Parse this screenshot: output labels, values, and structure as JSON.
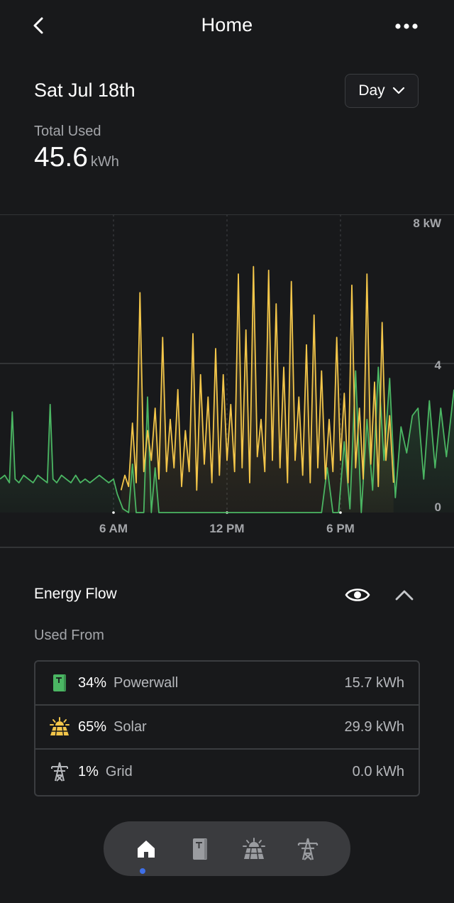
{
  "header": {
    "title": "Home"
  },
  "summary": {
    "date": "Sat Jul 18th",
    "period": "Day",
    "total_label": "Total Used",
    "total_value": "45.6",
    "total_unit": "kWh"
  },
  "colors": {
    "solar": "#f3c64a",
    "powerwall": "#4bb663",
    "accent": "#3e6fe8"
  },
  "chart_data": {
    "type": "line",
    "y_tick_labels": [
      "8 kW",
      "4",
      "0"
    ],
    "x_tick_labels": [
      "6 AM",
      "12 PM",
      "6 PM"
    ],
    "ylim": [
      0,
      8
    ],
    "xlim_hours": [
      0,
      24
    ],
    "series": [
      {
        "color": "#4bb663",
        "x": [
          0,
          0.25,
          0.5,
          0.65,
          0.8,
          1,
          1.25,
          1.5,
          1.75,
          2,
          2.25,
          2.5,
          2.65,
          2.8,
          3,
          3.25,
          3.5,
          3.75,
          4,
          4.25,
          4.5,
          4.75,
          5,
          5.25,
          5.5,
          5.75,
          6,
          6.2,
          6.5,
          6.8,
          7,
          7.2,
          7.4,
          7.6,
          7.8,
          8,
          8.2,
          8.4,
          8.6,
          8.8,
          9,
          9.5,
          10,
          10.5,
          11,
          11.5,
          12,
          12.5,
          13,
          13.5,
          14,
          14.5,
          15,
          15.5,
          16,
          16.5,
          17,
          17.3,
          17.6,
          17.9,
          18.2,
          18.5,
          18.8,
          19.1,
          19.4,
          19.7,
          20,
          20.3,
          20.6,
          20.9,
          21.2,
          21.5,
          21.8,
          22.1,
          22.4,
          22.7,
          23,
          23.3,
          23.6,
          24
        ],
        "values": [
          0.9,
          1,
          0.8,
          2.7,
          0.9,
          0.8,
          1,
          0.9,
          0.8,
          1,
          0.9,
          0.8,
          2.9,
          0.9,
          0.8,
          1,
          0.9,
          0.8,
          1,
          0.8,
          0.9,
          0.8,
          0.9,
          1,
          0.9,
          0.8,
          0.9,
          0.5,
          0.1,
          0,
          1.3,
          0,
          0,
          0,
          3.1,
          0,
          1.2,
          0,
          0,
          0,
          0,
          0,
          0,
          0,
          0,
          0,
          0,
          0,
          0,
          0,
          0,
          0,
          0,
          0,
          0,
          0,
          0,
          1.2,
          0,
          0,
          1.9,
          0.1,
          3.8,
          0,
          2.5,
          0.6,
          3.9,
          1.4,
          3.6,
          0.4,
          2.3,
          1.6,
          2.6,
          2.8,
          0.9,
          3,
          1.2,
          2.8,
          1.5,
          3.3
        ]
      },
      {
        "color": "#f3c64a",
        "x": [
          6.4,
          6.6,
          6.8,
          7,
          7.2,
          7.4,
          7.6,
          7.8,
          8,
          8.2,
          8.4,
          8.6,
          8.8,
          9,
          9.2,
          9.4,
          9.6,
          9.8,
          10,
          10.2,
          10.4,
          10.6,
          10.8,
          11,
          11.2,
          11.4,
          11.6,
          11.8,
          12,
          12.2,
          12.4,
          12.6,
          12.8,
          13,
          13.2,
          13.4,
          13.6,
          13.8,
          14,
          14.2,
          14.4,
          14.6,
          14.8,
          15,
          15.2,
          15.4,
          15.6,
          15.8,
          16,
          16.2,
          16.4,
          16.6,
          16.8,
          17,
          17.2,
          17.4,
          17.6,
          17.8,
          18,
          18.2,
          18.4,
          18.6,
          18.8,
          19,
          19.2,
          19.4,
          19.6,
          19.8,
          20,
          20.2,
          20.4,
          20.6,
          20.8
        ],
        "values": [
          0.6,
          1,
          0.7,
          2.4,
          0.8,
          5.9,
          1.1,
          2.2,
          1.4,
          2.8,
          0.9,
          4.7,
          1.1,
          2.5,
          1.2,
          3.3,
          0.7,
          2.2,
          1.1,
          4.8,
          0.6,
          3.7,
          1.3,
          3.1,
          0.8,
          4.4,
          1,
          3.7,
          1.4,
          2.9,
          1.1,
          6.4,
          1.2,
          4.9,
          0.8,
          6.6,
          1.5,
          2.5,
          1.1,
          6.5,
          1.4,
          5.6,
          1.2,
          3.9,
          0.8,
          6.2,
          1.4,
          3.1,
          1,
          4.5,
          0.8,
          5.3,
          1.2,
          3.8,
          0.9,
          2.5,
          1.1,
          4.7,
          1.4,
          3.2,
          0.8,
          6.1,
          1.2,
          2.8,
          0.9,
          6.4,
          1.3,
          3.5,
          0.7,
          5.1,
          1.4,
          2.6,
          0.8
        ]
      }
    ],
    "grid": true
  },
  "energy_flow": {
    "title": "Energy Flow",
    "used_from_label": "Used From",
    "sources": [
      {
        "percent": "34%",
        "name": "Powerwall",
        "value": "15.7 kWh",
        "icon": "powerwall-icon"
      },
      {
        "percent": "65%",
        "name": "Solar",
        "value": "29.9 kWh",
        "icon": "solar-icon"
      },
      {
        "percent": "1%",
        "name": "Grid",
        "value": "0.0 kWh",
        "icon": "grid-tower-icon"
      }
    ]
  },
  "nav": {
    "items": [
      "home-icon",
      "powerwall-icon",
      "solar-icon",
      "grid-tower-icon"
    ],
    "active": 0
  }
}
